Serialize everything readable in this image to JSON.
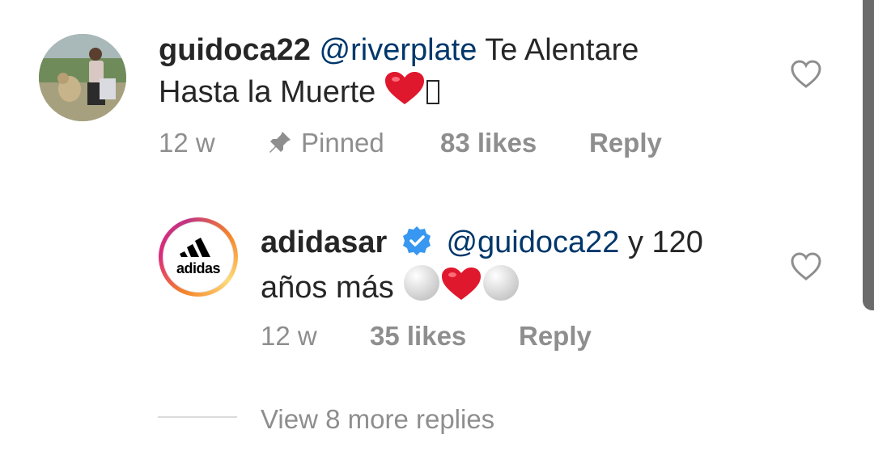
{
  "comments": [
    {
      "username": "guidoca22",
      "mention": "@riverplate",
      "text_line1": "Te Alentare",
      "text_line2": "Hasta la Muerte",
      "time": "12 w",
      "pinned_label": "Pinned",
      "likes": "83 likes",
      "reply_label": "Reply",
      "icons": [
        "avatar-photo",
        "heart-emoji",
        "pin-icon",
        "like-heart-icon"
      ]
    },
    {
      "username": "adidasar",
      "verified": true,
      "mention": "@guidoca22",
      "text_line1": "y 120",
      "text_line2": "años más",
      "avatar_logo_text": "adidas",
      "time": "12 w",
      "likes": "35 likes",
      "reply_label": "Reply",
      "icons": [
        "adidas-logo",
        "verified-badge-icon",
        "ball-emoji",
        "heart-emoji",
        "like-heart-icon"
      ]
    }
  ],
  "view_more_replies": "View 8 more replies",
  "colors": {
    "text": "#262626",
    "mention": "#00376b",
    "meta": "#8e8e8e",
    "verified": "#3897f0",
    "emoji_heart": "#e0182d"
  }
}
